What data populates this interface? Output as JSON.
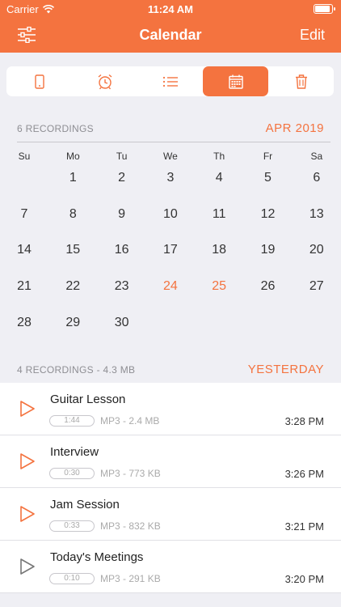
{
  "status": {
    "carrier": "Carrier",
    "time": "11:24 AM",
    "battery_level": 0.95
  },
  "nav": {
    "title": "Calendar",
    "edit_label": "Edit"
  },
  "segments": [
    {
      "icon": "phone-icon",
      "active": false
    },
    {
      "icon": "alarm-clock-icon",
      "active": false
    },
    {
      "icon": "list-icon",
      "active": false
    },
    {
      "icon": "calendar-icon",
      "active": true
    },
    {
      "icon": "trash-icon",
      "active": false
    }
  ],
  "calendar": {
    "summary": "6 RECORDINGS",
    "month": "APR 2019",
    "weekdays": [
      "Su",
      "Mo",
      "Tu",
      "We",
      "Th",
      "Fr",
      "Sa"
    ],
    "first_weekday_index": 1,
    "days_in_month": 30,
    "recording_days": [
      {
        "day": 24,
        "count": "4",
        "badge_color": "#e8612b"
      },
      {
        "day": 25,
        "count": "2",
        "badge_color": "#f4a283"
      }
    ]
  },
  "recordings_section": {
    "summary": "4 RECORDINGS - 4.3 MB",
    "label": "YESTERDAY"
  },
  "recordings": [
    {
      "title": "Guitar Lesson",
      "duration": "1:44",
      "info": "MP3 - 2.4 MB",
      "time": "3:28 PM",
      "played": false
    },
    {
      "title": "Interview",
      "duration": "0:30",
      "info": "MP3 - 773 KB",
      "time": "3:26 PM",
      "played": false
    },
    {
      "title": "Jam Session",
      "duration": "0:33",
      "info": "MP3 - 832 KB",
      "time": "3:21 PM",
      "played": false
    },
    {
      "title": "Today's Meetings",
      "duration": "0:10",
      "info": "MP3 - 291 KB",
      "time": "3:20 PM",
      "played": true
    }
  ],
  "colors": {
    "accent": "#f4733f",
    "played_icon": "#777777"
  }
}
